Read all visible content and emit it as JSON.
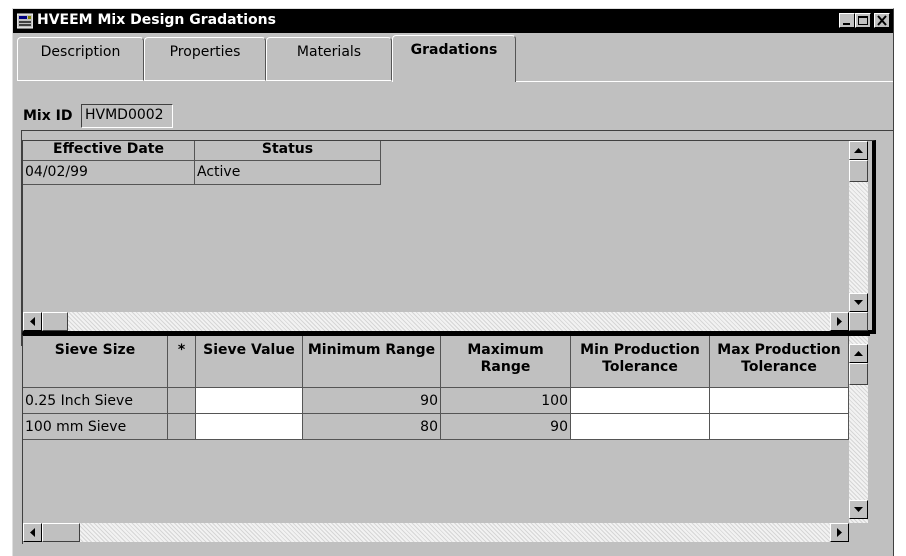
{
  "window": {
    "title": "HVEEM Mix Design Gradations"
  },
  "tabs": [
    {
      "label": "Description"
    },
    {
      "label": "Properties"
    },
    {
      "label": "Materials"
    },
    {
      "label": "Gradations",
      "active": true
    }
  ],
  "mix": {
    "label": "Mix ID",
    "value": "HVMD0002"
  },
  "status_grid": {
    "columns": [
      "Effective Date",
      "Status"
    ],
    "rows": [
      {
        "effective_date": "04/02/99",
        "status": "Active"
      }
    ]
  },
  "gradation_grid": {
    "columns": [
      "Sieve Size",
      "*",
      "Sieve Value",
      "Minimum Range",
      "Maximum Range",
      "Min Production Tolerance",
      "Max Production Tolerance"
    ],
    "rows": [
      {
        "sieve_size": "0.25 Inch Sieve",
        "star": "",
        "sieve_value": "",
        "min_range": "90",
        "max_range": "100",
        "min_tol": "",
        "max_tol": ""
      },
      {
        "sieve_size": "100 mm Sieve",
        "star": "",
        "sieve_value": "",
        "min_range": "80",
        "max_range": "90",
        "min_tol": "",
        "max_tol": ""
      }
    ]
  },
  "icons": {
    "app": "app-window-icon",
    "minimize": "minimize-icon",
    "maximize": "maximize-icon",
    "close": "close-icon",
    "scroll_up": "arrow-up-icon",
    "scroll_down": "arrow-down-icon",
    "scroll_left": "arrow-left-icon",
    "scroll_right": "arrow-right-icon"
  },
  "colors": {
    "titlebar": "#000000",
    "face": "#c0c0c0",
    "field": "#ffffff"
  }
}
